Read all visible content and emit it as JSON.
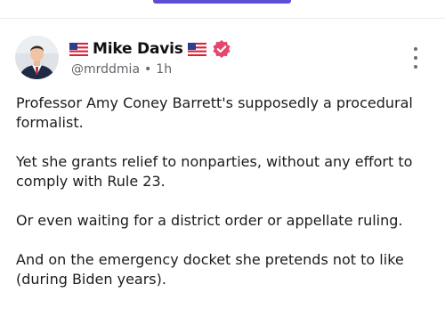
{
  "colors": {
    "accent": "#5b4fd6",
    "badge": "#e5466b",
    "text": "#1c1c1f",
    "muted": "#64646b"
  },
  "post": {
    "author": {
      "display_name": "Mike Davis",
      "handle": "@mrddmia",
      "flag_left": "us-flag-icon",
      "flag_right": "us-flag-icon",
      "badge": "verified-badge-icon",
      "avatar": "avatar"
    },
    "separator": "•",
    "time": "1h",
    "menu_icon": "more-vertical-icon",
    "paragraphs": [
      "Professor Amy Coney Barrett's supposedly a procedural formalist.",
      "Yet she grants relief to nonparties, without any effort to comply with Rule 23.",
      "Or even waiting for a district order or appellate ruling.",
      "And on the emergency docket she pretends not to like (during Biden years)."
    ]
  }
}
